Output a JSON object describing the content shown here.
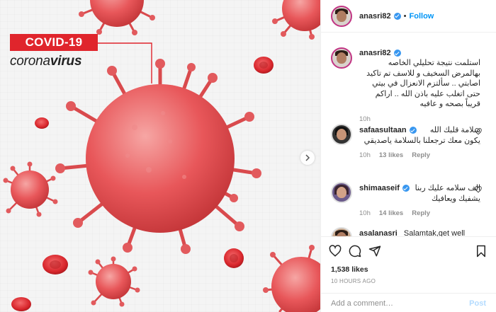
{
  "image": {
    "badge": "COVID-19",
    "subtitle_light": "corona",
    "subtitle_bold": "virus",
    "accent_color": "#e0252c",
    "virus_color": "#e8575a"
  },
  "header": {
    "username": "anasri82",
    "separator": "•",
    "follow_label": "Follow"
  },
  "caption": {
    "username": "anasri82",
    "text": "استلمت نتيجة تحليلي الخاصه بهالمرض السخيف و للاسف تم تاكيد اصابتي .. سألتزم الانعزال في بيتي حتى اتغلب عليه باذن الله .. اراكم قريباً بصحه و عافيه",
    "time": "10h"
  },
  "comments": [
    {
      "username": "safaasultaan",
      "text": "سلامة قلبك الله يكون معك ترجعلنا بالسلامة ياصديقي",
      "time": "10h",
      "likes": "13 likes",
      "reply": "Reply"
    },
    {
      "username": "shimaaseif",
      "text": "الف سلامه عليك ربنا يشفيك ويعافيك",
      "time": "10h",
      "likes": "14 likes",
      "reply": "Reply"
    },
    {
      "username": "asalanasri",
      "text": "Salamtak,get well"
    }
  ],
  "actions": {
    "likes": "1,538 likes",
    "time_ago": "10 HOURS AGO",
    "comment_placeholder": "Add a comment…",
    "post_label": "Post"
  }
}
